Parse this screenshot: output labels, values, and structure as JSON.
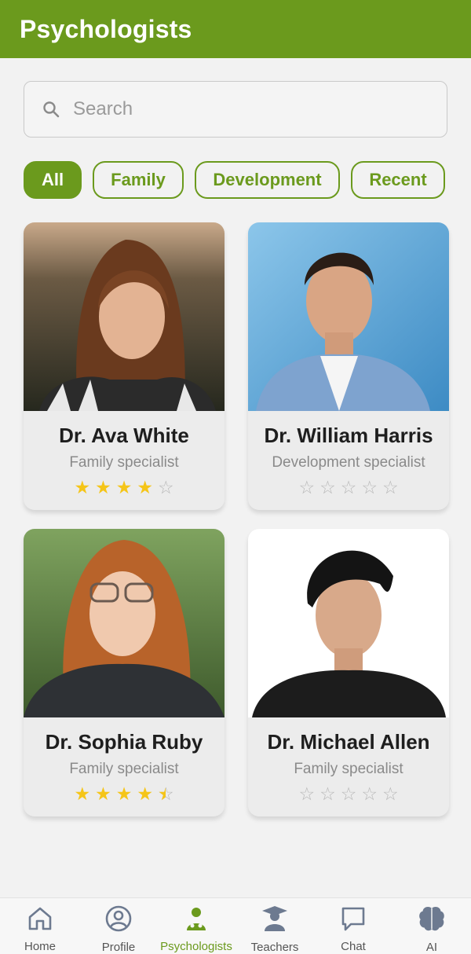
{
  "header": {
    "title": "Psychologists"
  },
  "search": {
    "placeholder": "Search",
    "value": ""
  },
  "filters": [
    {
      "label": "All",
      "active": true
    },
    {
      "label": "Family",
      "active": false
    },
    {
      "label": "Development",
      "active": false
    },
    {
      "label": "Recent",
      "active": false
    }
  ],
  "psychologists": [
    {
      "name": "Dr. Ava White",
      "specialty": "Family specialist",
      "rating": 4
    },
    {
      "name": "Dr. William Harris",
      "specialty": "Development specialist",
      "rating": 0
    },
    {
      "name": "Dr. Sophia Ruby",
      "specialty": "Family specialist",
      "rating": 4.5
    },
    {
      "name": "Dr. Michael Allen",
      "specialty": "Family specialist",
      "rating": 0
    }
  ],
  "nav": [
    {
      "label": "Home",
      "icon": "home-icon",
      "active": false
    },
    {
      "label": "Profile",
      "icon": "profile-icon",
      "active": false
    },
    {
      "label": "Psychologists",
      "icon": "psychologist-icon",
      "active": true
    },
    {
      "label": "Teachers",
      "icon": "teacher-icon",
      "active": false
    },
    {
      "label": "Chat",
      "icon": "chat-icon",
      "active": false
    },
    {
      "label": "AI",
      "icon": "brain-icon",
      "active": false
    }
  ],
  "colors": {
    "accent": "#6b9a1d",
    "star": "#f5c518"
  }
}
